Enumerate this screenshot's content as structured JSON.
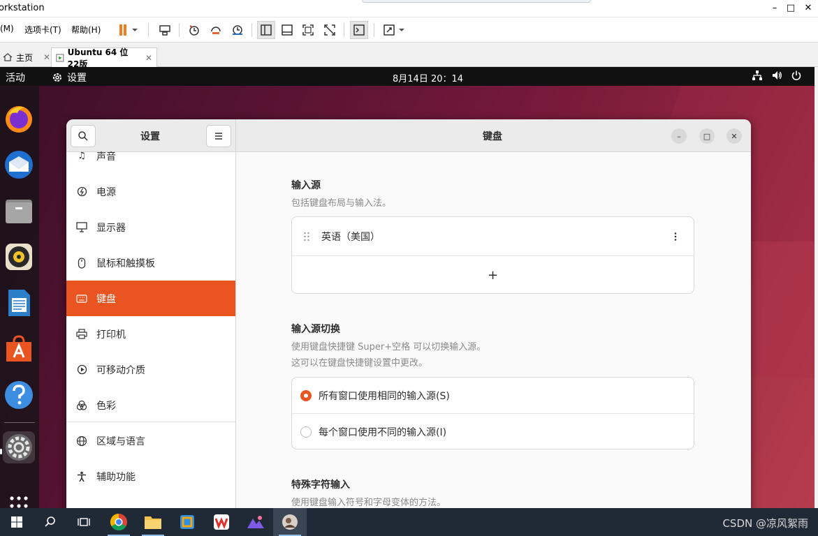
{
  "vm": {
    "title": "orkstation",
    "window_controls": [
      "–",
      "□",
      "✕"
    ],
    "menus": [
      "(M)",
      "选项卡(T)",
      "帮助(H)"
    ],
    "tabs": [
      {
        "label": "主页",
        "close": "✕"
      },
      {
        "label": "Ubuntu 64 位22版",
        "close": "✕"
      }
    ]
  },
  "ubuntu": {
    "activities": "活动",
    "app_name": "设置",
    "clock": "8月14日  20：14"
  },
  "settings": {
    "sidebar_title": "设置",
    "page_title": "键盘",
    "window_controls": [
      "–",
      "□",
      "✕"
    ],
    "sidebar_items": [
      {
        "label": "声音",
        "icon": "music-note-icon"
      },
      {
        "label": "电源",
        "icon": "power-icon"
      },
      {
        "label": "显示器",
        "icon": "display-icon"
      },
      {
        "label": "鼠标和触摸板",
        "icon": "mouse-icon"
      },
      {
        "label": "键盘",
        "icon": "keyboard-icon",
        "selected": true
      },
      {
        "label": "打印机",
        "icon": "printer-icon"
      },
      {
        "label": "可移动介质",
        "icon": "media-icon"
      },
      {
        "label": "色彩",
        "icon": "color-icon"
      },
      {
        "label": "区域与语言",
        "icon": "globe-icon"
      },
      {
        "label": "辅助功能",
        "icon": "accessibility-icon"
      }
    ],
    "input_sources": {
      "title": "输入源",
      "desc": "包括键盘布局与输入法。",
      "items": [
        "英语（美国）"
      ],
      "add": "+"
    },
    "switching": {
      "title": "输入源切换",
      "desc1": "使用键盘快捷键 Super+空格 可以切换输入源。",
      "desc2": "这可以在键盘快捷键设置中更改。",
      "options": [
        {
          "label": "所有窗口使用相同的输入源(S)",
          "checked": true
        },
        {
          "label": "每个窗口使用不同的输入源(I)",
          "checked": false
        }
      ]
    },
    "special_chars": {
      "title": "特殊字符输入",
      "desc": "使用键盘输入符号和字母变体的方法。"
    }
  },
  "taskbar": {
    "watermark": "CSDN @凉风絮雨"
  },
  "colors": {
    "ubuntu_orange": "#e95420",
    "vm_pause": "#f07d1a",
    "taskbar": "#1f2a36"
  }
}
